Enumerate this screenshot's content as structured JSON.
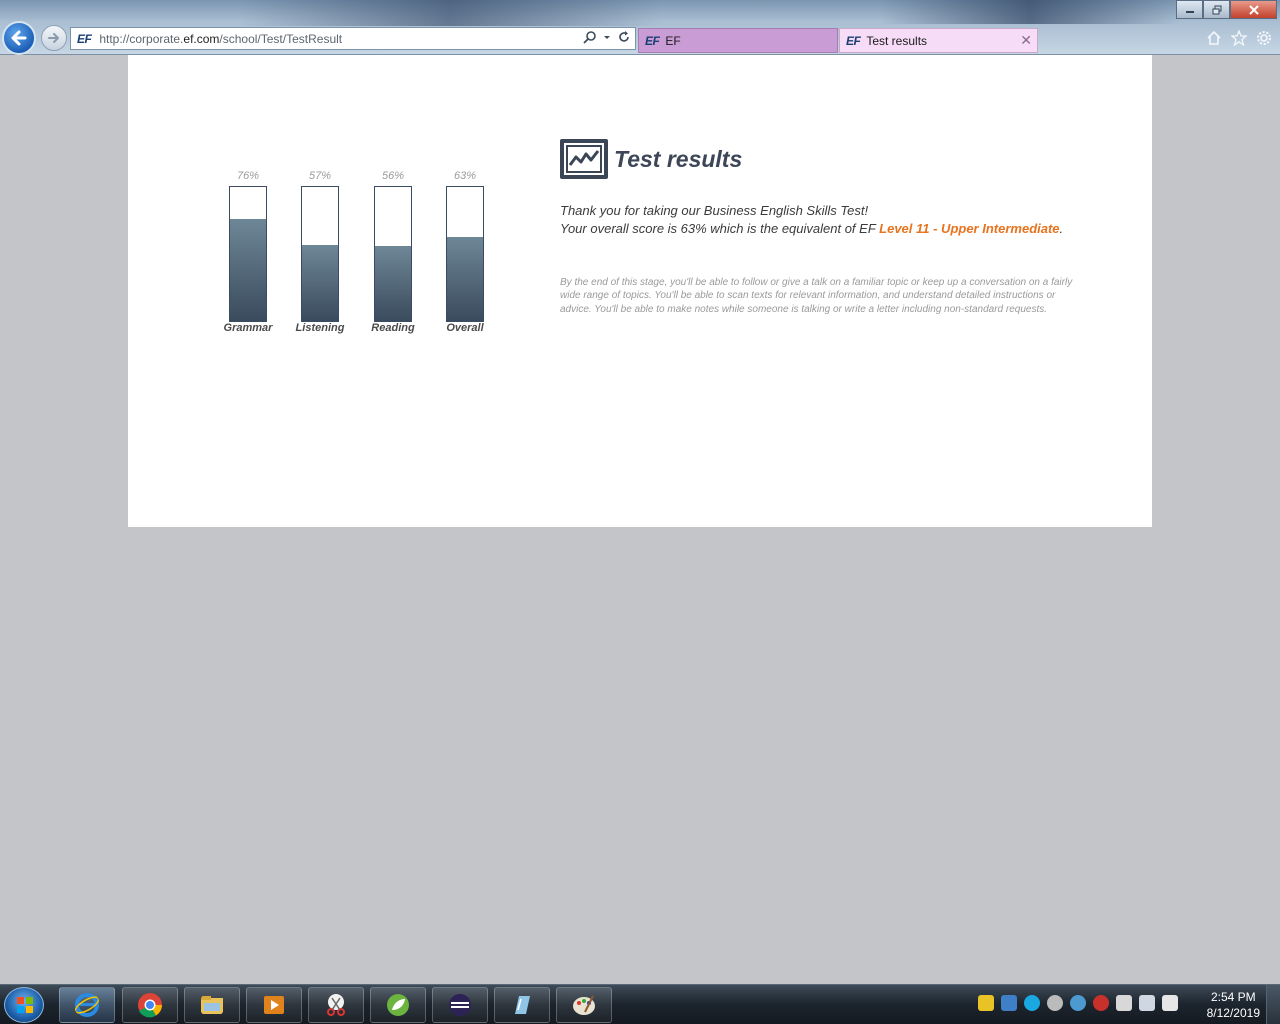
{
  "browser": {
    "url_prefix": "http://corporate.",
    "url_domain": "ef.com",
    "url_path": "/school/Test/TestResult",
    "logo_text": "EF",
    "tabs": [
      {
        "label": "EF"
      },
      {
        "label": "Test results"
      }
    ],
    "close_tab_glyph": "✕"
  },
  "page": {
    "title": "Test results",
    "thanks_line": "Thank you for taking our Business English Skills Test!",
    "score_line": "Your overall score is 63% which is the equivalent of EF ",
    "level_text": "Level 11 - Upper Intermediate",
    "level_suffix": ".",
    "stage_description": "By the end of this stage, you'll be able to follow or give a talk on a familiar topic or keep up a conversation on a fairly wide range of topics. You'll be able to scan texts for relevant information, and understand detailed instructions or advice. You'll be able to make notes while someone is talking or write a letter including non-standard requests.",
    "accent_color": "#e8731e"
  },
  "chart_data": {
    "type": "bar",
    "categories": [
      "Grammar",
      "Listening",
      "Reading",
      "Overall"
    ],
    "values": [
      76,
      57,
      56,
      63
    ],
    "value_labels": [
      "76%",
      "57%",
      "56%",
      "63%"
    ],
    "ylim": [
      0,
      100
    ],
    "title": "",
    "xlabel": "",
    "ylabel": ""
  },
  "taskbar": {
    "clock_time": "2:54 PM",
    "clock_date": "8/12/2019",
    "apps": [
      "internet-explorer",
      "chrome",
      "file-explorer",
      "media-player",
      "snipping-tool",
      "spring-tool",
      "eclipse",
      "notepad",
      "paint"
    ]
  }
}
